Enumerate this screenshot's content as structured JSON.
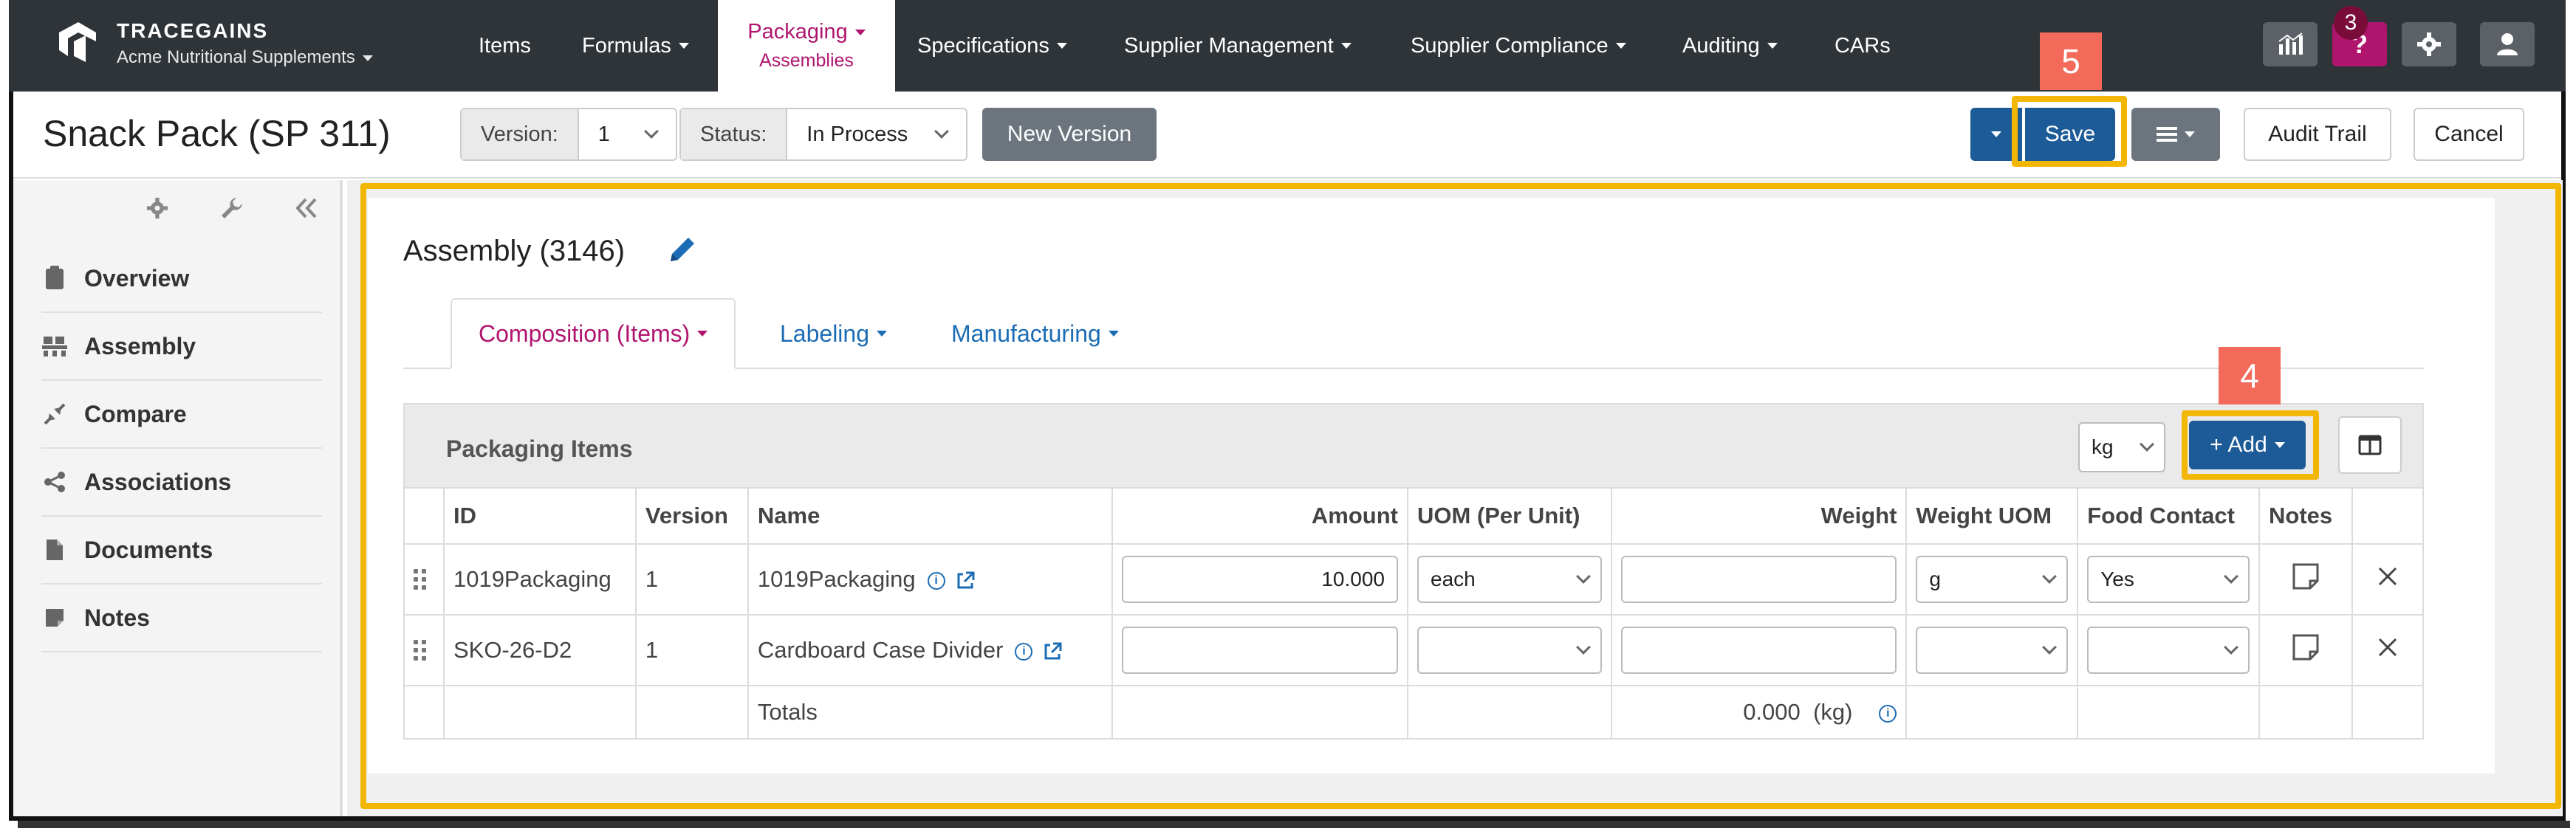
{
  "brand": {
    "name": "TRACEGAINS",
    "company": "Acme Nutritional Supplements"
  },
  "nav": {
    "items": [
      "Items",
      "Formulas",
      "Packaging",
      "Specifications",
      "Supplier Management",
      "Supplier Compliance",
      "Auditing",
      "CARs"
    ],
    "active_sub": "Assemblies",
    "help_label": "?",
    "badge_count": "3"
  },
  "header": {
    "title": "Snack Pack (SP 311)",
    "version_label": "Version:",
    "version_value": "1",
    "status_label": "Status:",
    "status_value": "In Process",
    "new_version": "New Version",
    "save": "Save",
    "audit_trail": "Audit Trail",
    "cancel": "Cancel"
  },
  "callouts": {
    "save_step": "5",
    "add_step": "4"
  },
  "sidebar": {
    "items": [
      {
        "label": "Overview",
        "icon": "clipboard-icon"
      },
      {
        "label": "Assembly",
        "icon": "pallet-icon"
      },
      {
        "label": "Compare",
        "icon": "compare-icon"
      },
      {
        "label": "Associations",
        "icon": "share-icon"
      },
      {
        "label": "Documents",
        "icon": "document-icon"
      },
      {
        "label": "Notes",
        "icon": "note-icon"
      }
    ]
  },
  "assembly": {
    "title": "Assembly (3146)",
    "tabs": [
      "Composition (Items)",
      "Labeling",
      "Manufacturing"
    ],
    "panel_title": "Packaging Items",
    "unit": "kg",
    "add": "+ Add",
    "columns": [
      "ID",
      "Version",
      "Name",
      "Amount",
      "UOM (Per Unit)",
      "Weight",
      "Weight UOM",
      "Food Contact",
      "Notes"
    ],
    "rows": [
      {
        "id": "1019Packaging",
        "version": "1",
        "name": "1019Packaging",
        "amount": "10.000",
        "uom": "each",
        "weight": "",
        "weight_uom": "g",
        "food_contact": "Yes"
      },
      {
        "id": "SKO-26-D2",
        "version": "1",
        "name": "Cardboard Case Divider",
        "amount": "",
        "uom": "",
        "weight": "",
        "weight_uom": "",
        "food_contact": ""
      }
    ],
    "totals_label": "Totals",
    "totals_value": "0.000",
    "totals_unit": "(kg)"
  },
  "colors": {
    "nav_bg": "#2f3439",
    "accent_magenta": "#b0156e",
    "primary_blue": "#1c5b97",
    "highlight": "#f2b705",
    "callout": "#f36a5a"
  }
}
